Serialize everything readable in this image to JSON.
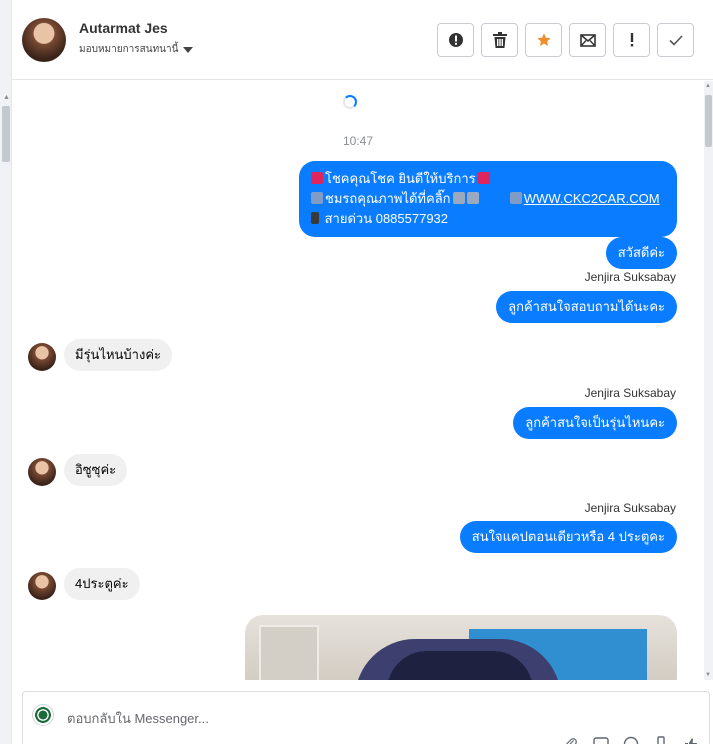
{
  "header": {
    "contact_name": "Autarmat Jes",
    "assign_label": "มอบหมายการสนทนานี้",
    "actions": [
      {
        "name": "report-spam-button",
        "icon": "alert-circle-icon"
      },
      {
        "name": "delete-button",
        "icon": "trash-icon"
      },
      {
        "name": "star-button",
        "icon": "star-icon"
      },
      {
        "name": "mark-unread-button",
        "icon": "envelope-icon"
      },
      {
        "name": "mark-important-button",
        "icon": "exclamation-icon"
      },
      {
        "name": "mark-done-button",
        "icon": "check-icon"
      }
    ]
  },
  "thread": {
    "timestamp": "10:47",
    "messages": [
      {
        "direction": "out",
        "line1": "โชคคุณโชค ยินดีให้บริการ",
        "line2_text": "ชมรถคุณภาพได้ที่คลิ๊ก",
        "line2_link": "WWW.CKC2CAR.COM",
        "line3": "สายด่วน 0885577932"
      },
      {
        "direction": "out",
        "text": "สวัสดีค่ะ"
      },
      {
        "direction": "out",
        "sender": "Jenjira Suksabay",
        "text": "ลูกค้าสนใจสอบถามได้นะคะ"
      },
      {
        "direction": "in",
        "text": "มีรุ่นไหนบ้างค่ะ"
      },
      {
        "direction": "out",
        "sender": "Jenjira Suksabay",
        "text": "ลูกค้าสนใจเป็นรุ่นไหนคะ"
      },
      {
        "direction": "in",
        "text": "อิซูซุค่ะ"
      },
      {
        "direction": "out",
        "sender": "Jenjira Suksabay",
        "text": "สนใจแคปตอนเดียวหรือ 4 ประตูคะ"
      },
      {
        "direction": "in",
        "text": "4ประตูค่ะ"
      }
    ]
  },
  "composer": {
    "placeholder": "ตอบกลับใน Messenger..."
  },
  "colors": {
    "outgoing_bubble": "#0a7cff",
    "incoming_bubble": "#f0f0f0",
    "star": "#f28c28"
  }
}
